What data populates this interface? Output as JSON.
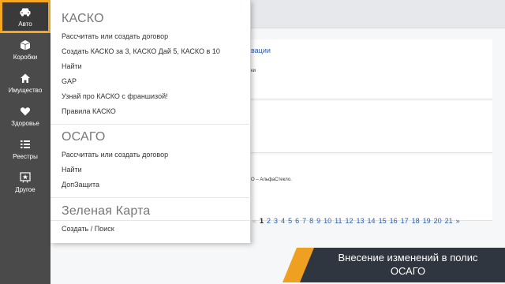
{
  "sidebar": {
    "items": [
      {
        "label": "Авто",
        "icon": "car-icon",
        "glyph": "🚗"
      },
      {
        "label": "Коробки",
        "icon": "box-icon",
        "glyph": "📦"
      },
      {
        "label": "Имущество",
        "icon": "home-icon",
        "glyph": "⌂"
      },
      {
        "label": "Здоровье",
        "icon": "heart-icon",
        "glyph": "♥"
      },
      {
        "label": "Реестры",
        "icon": "list-icon",
        "glyph": "☰"
      },
      {
        "label": "Другое",
        "icon": "star-icon",
        "glyph": "✦"
      }
    ]
  },
  "menu": {
    "kasko": {
      "title": "КАСКО",
      "items": [
        "Рассчитать или создать договор",
        "Создать КАСКО за 3, КАСКО Дай 5, КАСКО в 10",
        "Найти",
        "GAP",
        "Узнай про КАСКО с франшизой!",
        "Правила КАСКО"
      ]
    },
    "osago": {
      "title": "ОСАГО",
      "items": [
        "Рассчитать или создать договор",
        "Найти",
        "ДопЗащита"
      ]
    },
    "green_card": {
      "title": "Зеленая Карта",
      "items": [
        "Создать / Поиск"
      ]
    }
  },
  "background": {
    "link1": "вации",
    "small1": "ки",
    "small2": "О – АльфаСтекло.",
    "pagination": {
      "prev": "«",
      "pages": [
        "1",
        "2",
        "3",
        "4",
        "5",
        "6",
        "7",
        "8",
        "9",
        "10",
        "11",
        "12",
        "13",
        "14",
        "15",
        "16",
        "17",
        "18",
        "19",
        "20",
        "21"
      ],
      "current": "1",
      "next": "»"
    }
  },
  "banner": {
    "line1": "Внесение изменений в полис",
    "line2": "ОСАГО"
  },
  "colors": {
    "accent": "#f5a623",
    "sidebar": "#4a4a4a",
    "link": "#2a5db0"
  }
}
